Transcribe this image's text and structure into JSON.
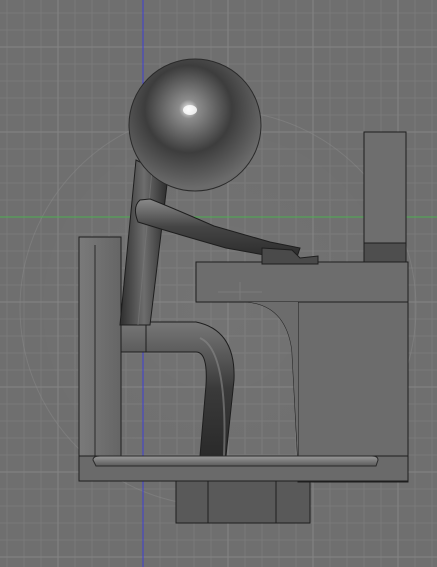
{
  "viewport": {
    "background_color": "#6f6f6f",
    "grid_minor_color": "#7a7a7a",
    "grid_major_color": "#848484",
    "x_axis_color": "#4caf50",
    "y_axis_color": "#3f3fd6"
  },
  "model": {
    "body_color": "#4a4a4a",
    "head_highlight_color": "#f2f2f2",
    "desk_color": "#6a6a6a",
    "chair_color": "#6b6b6b",
    "outline_color": "#1e1e1e"
  }
}
